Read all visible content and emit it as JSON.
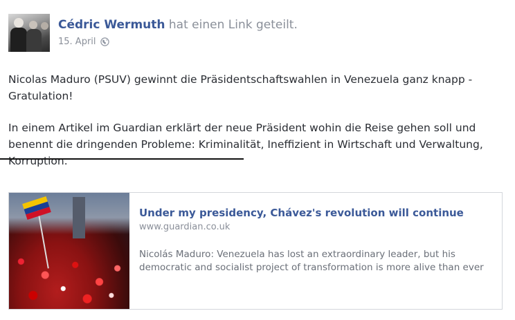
{
  "post": {
    "author": "Cédric Wermuth",
    "action": "hat einen Link geteilt.",
    "date": "15. April",
    "privacy_icon": "globe-icon",
    "paragraph1": "Nicolas Maduro (PSUV) gewinnt die Präsidentschaftswahlen in Venezuela ganz knapp - Gratulation!",
    "paragraph2_part1": "In einem Artikel im Guardian erklärt der neue Präsident wohin die Reise gehen soll ",
    "paragraph2_struck": "und benennt die dringenden Probleme",
    "paragraph2_part2": ": Kriminalität, Ineffizient in Wirtschaft und Verwaltung, Korruption."
  },
  "link": {
    "title": "Under my presidency, Chávez's revolution will continue",
    "domain": "www.guardian.co.uk",
    "description": "Nicolás Maduro: Venezuela has lost an extraordinary leader, but his democratic and socialist project of transformation is more alive than ever"
  },
  "colors": {
    "author": "#3b5998",
    "muted": "#8a8f99",
    "strike_line": "#111111"
  }
}
